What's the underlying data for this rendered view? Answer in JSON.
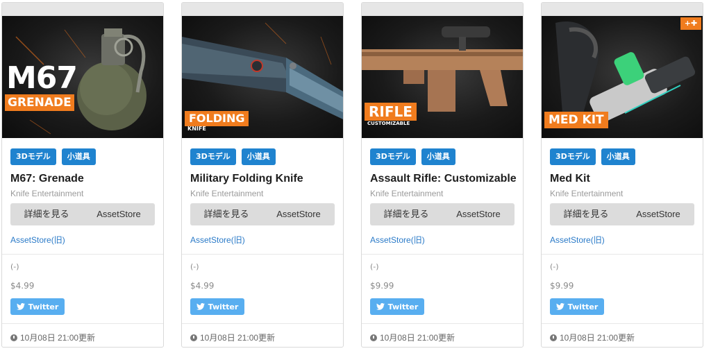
{
  "cards": [
    {
      "image_label_main": "M67",
      "image_label_sub": "GRENADE",
      "tags": [
        "3Dモデル",
        "小道具"
      ],
      "title": "M67: Grenade",
      "publisher": "Knife Entertainment",
      "details_button": "詳細を見る",
      "store_button": "AssetStore",
      "old_link": "AssetStore(旧)",
      "rating": "(-)",
      "price": "$4.99",
      "twitter_label": "Twitter",
      "updated": "10月08日 21:00更新"
    },
    {
      "image_label_main": "FOLDING",
      "image_label_sub": "KNIFE",
      "tags": [
        "3Dモデル",
        "小道具"
      ],
      "title": "Military Folding Knife",
      "publisher": "Knife Entertainment",
      "details_button": "詳細を見る",
      "store_button": "AssetStore",
      "old_link": "AssetStore(旧)",
      "rating": "(-)",
      "price": "$4.99",
      "twitter_label": "Twitter",
      "updated": "10月08日 21:00更新"
    },
    {
      "image_label_main": "RIFLE",
      "image_label_sub": "CUSTOMIZABLE",
      "tags": [
        "3Dモデル",
        "小道具"
      ],
      "title": "Assault Rifle: Customizable",
      "publisher": "Knife Entertainment",
      "details_button": "詳細を見る",
      "store_button": "AssetStore",
      "old_link": "AssetStore(旧)",
      "rating": "(-)",
      "price": "$9.99",
      "twitter_label": "Twitter",
      "updated": "10月08日 21:00更新"
    },
    {
      "image_label_main": "MED KIT",
      "image_label_sub": "",
      "tags": [
        "3Dモデル",
        "小道具"
      ],
      "title": "Med Kit",
      "publisher": "Knife Entertainment",
      "details_button": "詳細を見る",
      "store_button": "AssetStore",
      "old_link": "AssetStore(旧)",
      "rating": "(-)",
      "price": "$9.99",
      "twitter_label": "Twitter",
      "updated": "10月08日 21:00更新"
    }
  ],
  "colors": {
    "tag_blue": "#1f83cf",
    "twitter_blue": "#58aef0",
    "image_label_orange": "#f07c1e",
    "link_blue": "#2a7ac8"
  }
}
